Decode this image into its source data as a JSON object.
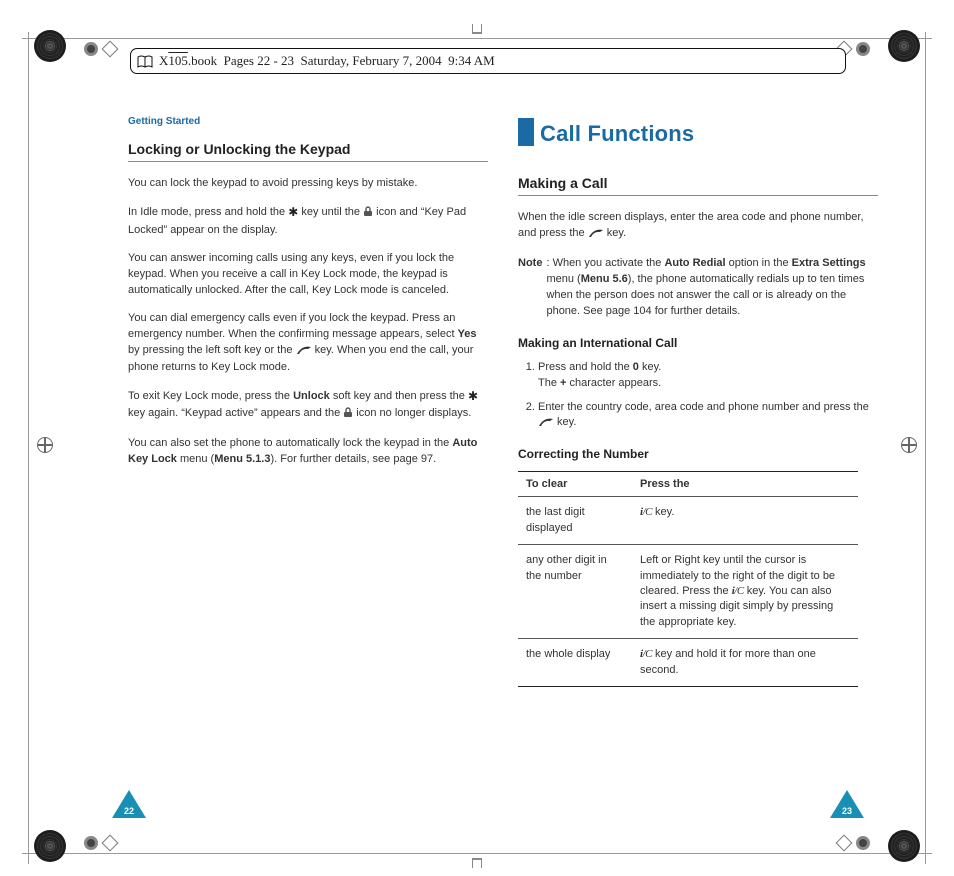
{
  "header": {
    "line": "X105.book  Pages 22 - 23  Saturday, February 7, 2004  9:34 AM",
    "overline_segment": "105"
  },
  "left": {
    "running_head": "Getting Started",
    "title": "Locking or Unlocking the Keypad",
    "p1": "You can lock the keypad to avoid pressing keys by mistake.",
    "p2a": "In Idle mode, press and hold the ",
    "p2b": " key until the ",
    "p2c": " icon and “Key Pad Locked” appear on the display.",
    "p3": "You can answer incoming calls using any keys, even if you lock the keypad. When you receive a call in Key Lock mode, the keypad is automatically unlocked. After the call, Key Lock mode is canceled.",
    "p4a": "You can dial emergency calls even if you lock the keypad. Press an emergency number. When the confirming message appears, select ",
    "p4_yes": "Yes",
    "p4b": " by pressing the left soft key or the ",
    "p4c": " key. When you end the call, your phone returns to Key Lock mode.",
    "p5a": "To exit Key Lock mode, press the ",
    "p5_unlock": "Unlock",
    "p5b": " soft key and then press the ",
    "p5c": " key again. “Keypad active” appears and the ",
    "p5d": " icon no longer displays.",
    "p6a": "You can also set the phone to automatically lock the keypad in the ",
    "p6_autokey": "Auto Key Lock",
    "p6b": " menu (",
    "p6_menu": "Menu 5.1.3",
    "p6c": "). For further details, see page 97.",
    "page_num": "22"
  },
  "right": {
    "chapter": "Call Functions",
    "s1_title": "Making a Call",
    "s1_p1a": "When the idle screen displays, enter the area code and phone number, and press the ",
    "s1_p1b": " key.",
    "note_label": "Note",
    "note_a": ": When you activate the ",
    "note_autoredial": "Auto Redial",
    "note_b": " option in the ",
    "note_extra": "Extra Settings",
    "note_c": " menu (",
    "note_menu": "Menu 5.6",
    "note_d": "), the phone automatically redials up to ten times when the person does not answer the call or is already on the phone. See page 104 for further details.",
    "s2_title": "Making an International Call",
    "step1a": "Press and hold the ",
    "step1_zero": "0",
    "step1b": " key.",
    "step1c": "The ",
    "step1_plus": "+",
    "step1d": " character appears.",
    "step2a": "Enter the country code, area code and phone number and press the ",
    "step2b": " key.",
    "s3_title": "Correcting the Number",
    "th1": "To clear",
    "th2": "Press the",
    "r1c1": "the last digit displayed",
    "r1c2a": " key.",
    "r2c1": "any other digit in the number",
    "r2c2a": "Left or Right key until the cursor is immediately to the right of the digit to be cleared. Press the ",
    "r2c2b": " key. You can also insert a missing digit simply by pressing the appropriate key.",
    "r3c1": "the whole display",
    "r3c2a": " key and hold it for more than one second.",
    "page_num": "23"
  }
}
